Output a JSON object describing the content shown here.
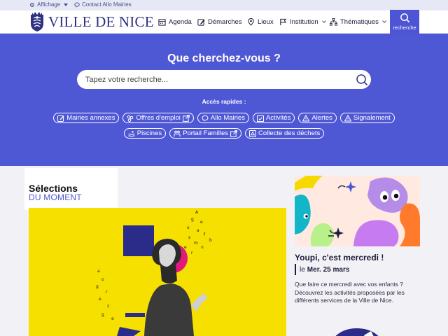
{
  "utility": {
    "affichage": "Affichage",
    "contact": "Contact Allo Mairies"
  },
  "header": {
    "logo_text": "VILLE DE NICE",
    "nav": {
      "agenda": "Agenda",
      "demarches": "Démarches",
      "lieux": "Lieux",
      "institution": "Institution",
      "thematiques": "Thématiques"
    },
    "search_label": "recherche"
  },
  "hero": {
    "title": "Que cherchez-vous ?",
    "search_placeholder": "Tapez votre recherche...",
    "quick_label": "Accès rapides :",
    "chips_row1": [
      "Mairies annexes",
      "Offres d'emploi",
      "Allo Mairies",
      "Activités",
      "Alertes",
      "Signalement"
    ],
    "chips_row2": [
      "Piscines",
      "Portail Familles",
      "Collecte des déchets"
    ]
  },
  "selections": {
    "title": "Sélections",
    "subtitle": "DU MOMENT"
  },
  "side_article": {
    "title": "Youpi, c'est mercredi !",
    "date_prefix": "le",
    "date": "Mer. 25 mars",
    "description": "Que faire ce mercredi avec vos enfants ? Découvrez les activités proposées par les différents services de la Ville de Nice."
  },
  "colors": {
    "brand_blue": "#4f58d4",
    "logo_blue": "#2d3282",
    "feature_yellow": "#f5e000"
  }
}
